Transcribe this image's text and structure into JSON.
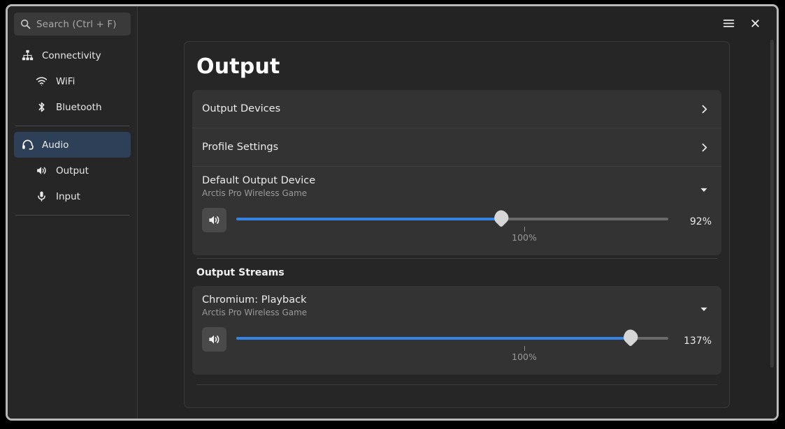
{
  "window": {
    "menu_icon": "hamburger-menu-icon",
    "close_icon": "close-icon"
  },
  "sidebar": {
    "search": {
      "placeholder": "Search (Ctrl + F)",
      "icon": "search-icon"
    },
    "items": [
      {
        "label": "Connectivity",
        "icon": "network-icon",
        "level": "parent",
        "active": false
      },
      {
        "label": "WiFi",
        "icon": "wifi-icon",
        "level": "child",
        "active": false
      },
      {
        "label": "Bluetooth",
        "icon": "bluetooth-icon",
        "level": "child",
        "active": false
      },
      {
        "label": "Audio",
        "icon": "headset-icon",
        "level": "parent",
        "active": true
      },
      {
        "label": "Output",
        "icon": "speaker-icon",
        "level": "child",
        "active": false
      },
      {
        "label": "Input",
        "icon": "microphone-icon",
        "level": "child",
        "active": false
      }
    ]
  },
  "main": {
    "title": "Output",
    "rows": [
      {
        "label": "Output Devices",
        "icon": "chevron-right-icon"
      },
      {
        "label": "Profile Settings",
        "icon": "chevron-right-icon"
      }
    ],
    "default_device": {
      "label": "Default Output Device",
      "sub": "Arctis Pro Wireless Game",
      "caret_icon": "chevron-down-icon",
      "mute_icon": "speaker-icon",
      "volume_percent": "92%",
      "volume_value": 92,
      "tick_label": "100%",
      "tick_value": 100,
      "slider_max": 150
    },
    "streams_section": {
      "heading": "Output Streams",
      "streams": [
        {
          "label": "Chromium: Playback",
          "sub": "Arctis Pro Wireless Game",
          "caret_icon": "chevron-down-icon",
          "mute_icon": "speaker-icon",
          "volume_percent": "137%",
          "volume_value": 137,
          "tick_label": "100%",
          "tick_value": 100,
          "slider_max": 150
        }
      ]
    }
  },
  "colors": {
    "accent": "#3584e4",
    "sidebar_active": "#2d4058",
    "card": "#333333",
    "panel": "#262626",
    "window_bg": "#232323"
  }
}
